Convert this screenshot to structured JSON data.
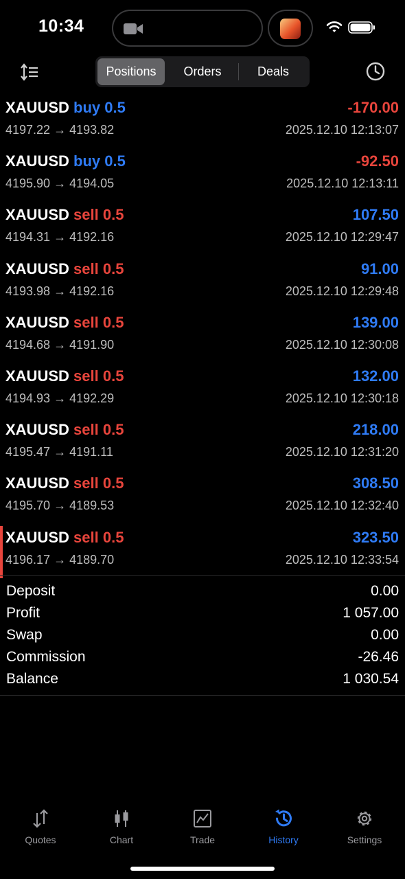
{
  "status_bar": {
    "time": "10:34"
  },
  "header": {
    "tabs": [
      {
        "label": "Positions",
        "active": true
      },
      {
        "label": "Orders",
        "active": false
      },
      {
        "label": "Deals",
        "active": false
      }
    ]
  },
  "deals": [
    {
      "symbol": "XAUUSD",
      "side": "buy",
      "volume": "0.5",
      "profit": "-170.00",
      "open": "4197.22",
      "close": "4193.82",
      "time": "2025.12.10 12:13:07"
    },
    {
      "symbol": "XAUUSD",
      "side": "buy",
      "volume": "0.5",
      "profit": "-92.50",
      "open": "4195.90",
      "close": "4194.05",
      "time": "2025.12.10 12:13:11"
    },
    {
      "symbol": "XAUUSD",
      "side": "sell",
      "volume": "0.5",
      "profit": "107.50",
      "open": "4194.31",
      "close": "4192.16",
      "time": "2025.12.10 12:29:47"
    },
    {
      "symbol": "XAUUSD",
      "side": "sell",
      "volume": "0.5",
      "profit": "91.00",
      "open": "4193.98",
      "close": "4192.16",
      "time": "2025.12.10 12:29:48"
    },
    {
      "symbol": "XAUUSD",
      "side": "sell",
      "volume": "0.5",
      "profit": "139.00",
      "open": "4194.68",
      "close": "4191.90",
      "time": "2025.12.10 12:30:08"
    },
    {
      "symbol": "XAUUSD",
      "side": "sell",
      "volume": "0.5",
      "profit": "132.00",
      "open": "4194.93",
      "close": "4192.29",
      "time": "2025.12.10 12:30:18"
    },
    {
      "symbol": "XAUUSD",
      "side": "sell",
      "volume": "0.5",
      "profit": "218.00",
      "open": "4195.47",
      "close": "4191.11",
      "time": "2025.12.10 12:31:20"
    },
    {
      "symbol": "XAUUSD",
      "side": "sell",
      "volume": "0.5",
      "profit": "308.50",
      "open": "4195.70",
      "close": "4189.53",
      "time": "2025.12.10 12:32:40"
    },
    {
      "symbol": "XAUUSD",
      "side": "sell",
      "volume": "0.5",
      "profit": "323.50",
      "open": "4196.17",
      "close": "4189.70",
      "time": "2025.12.10 12:33:54",
      "marked": true
    }
  ],
  "arrow_glyph": "→",
  "summary": [
    {
      "label": "Deposit",
      "value": "0.00"
    },
    {
      "label": "Profit",
      "value": "1 057.00"
    },
    {
      "label": "Swap",
      "value": "0.00"
    },
    {
      "label": "Commission",
      "value": "-26.46"
    },
    {
      "label": "Balance",
      "value": "1 030.54"
    }
  ],
  "tabbar": [
    {
      "label": "Quotes",
      "icon": "quotes-arrows-icon",
      "active": false
    },
    {
      "label": "Chart",
      "icon": "candlestick-chart-icon",
      "active": false
    },
    {
      "label": "Trade",
      "icon": "trade-line-chart-icon",
      "active": false
    },
    {
      "label": "History",
      "icon": "history-clock-icon",
      "active": true
    },
    {
      "label": "Settings",
      "icon": "gear-icon",
      "active": false
    }
  ],
  "colors": {
    "buy": "#2f7bf5",
    "sell": "#e8453c",
    "active_tab": "#2f7bf5",
    "inactive_tab": "#9a9a9e",
    "background": "#000000"
  }
}
